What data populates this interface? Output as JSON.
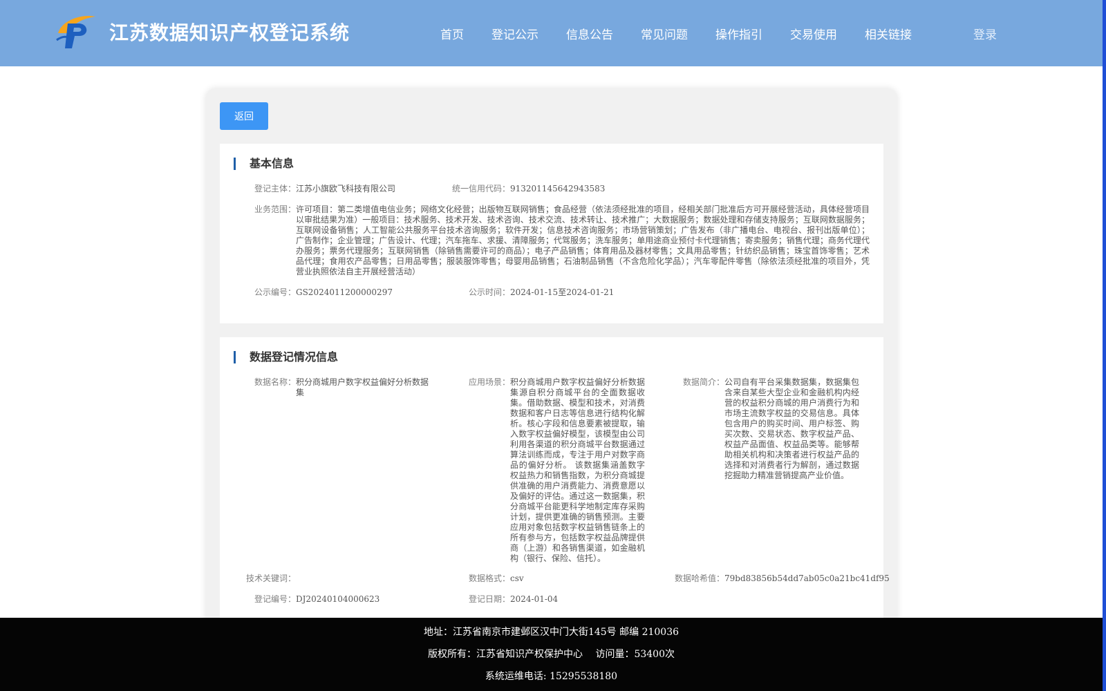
{
  "header": {
    "site_title": "江苏数据知识产权登记系统",
    "logo_icon": "ip-logo-icon",
    "nav": [
      "首页",
      "登记公示",
      "信息公告",
      "常见问题",
      "操作指引",
      "交易使用",
      "相关链接"
    ],
    "login": "登录"
  },
  "back_button": "返回",
  "basic_info": {
    "title": "基本信息",
    "entity_label": "登记主体：",
    "entity_value": "江苏小旗欧飞科技有限公司",
    "credit_label": "统一信用代码：",
    "credit_value": "91320114564294358З",
    "scope_label": "业务范围：",
    "scope_value": "许可项目：第二类增值电信业务；网络文化经营；出版物互联网销售；食品经营（依法须经批准的项目，经相关部门批准后方可开展经营活动，具体经营项目以审批结果为准）一般项目：技术服务、技术开发、技术咨询、技术交流、技术转让、技术推广；大数据服务；数据处理和存储支持服务；互联网数据服务；互联网设备销售；人工智能公共服务平台技术咨询服务；软件开发；信息技术咨询服务；市场营销策划；广告发布（非广播电台、电视台、报刊出版单位）；广告制作；企业管理；广告设计、代理；汽车拖车、求援、清障服务；代驾服务；洗车服务；单用途商业预付卡代理销售；寄卖服务；销售代理；商务代理代办服务；票务代理服务；互联网销售（除销售需要许可的商品）；电子产品销售；体育用品及器材零售；文具用品零售；针纺织品销售；珠宝首饰零售；艺术品代理；食用农产品零售；日用品零售；服装服饰零售；母婴用品销售；石油制品销售（不含危险化学品）；汽车零配件零售（除依法须经批准的项目外，凭营业执照依法自主开展经营活动）",
    "notice_no_label": "公示编号：",
    "notice_no_value": "GS2024011200000297",
    "notice_time_label": "公示时间：",
    "notice_time_value": "2024-01-15至2024-01-21"
  },
  "data_info": {
    "title": "数据登记情况信息",
    "name_label": "数据名称：",
    "name_value": "积分商城用户数字权益偏好分析数据集",
    "scene_label": "应用场景：",
    "scene_value": "积分商城用户数字权益偏好分析数据集源自积分商城平台的全面数据收集。借助数据、模型和技术，对消费数据和客户日志等信息进行结构化解析。核心字段和信息要素被提取，输入数字权益偏好模型，该模型由公司利用各渠道的积分商城平台数据通过算法训练而成，专注于用户对数字商品的偏好分析。 该数据集涵盖数字权益热力和销售指数，为积分商城提供准确的用户消费能力、消费意愿以及偏好的评估。通过这一数据集，积分商城平台能更科学地制定库存采购计划，提供更准确的销售预测。主要应用对象包括数字权益销售链条上的所有参与方，包括数字权益品牌提供商（上游）和各销售渠道，如金融机构（银行、保险、信托）。",
    "intro_label": "数据简介：",
    "intro_value": "公司自有平台采集数据集，数据集包含来自某些大型企业和金融机构内经营的权益积分商城的用户消费行为和市场主流数字权益的交易信息。具体包含用户的购买时间、用户标签、购买次数、交易状态、数字权益产品、权益产品面值、权益品类等。能够帮助相关机构和决策者进行权益产品的选择和对消费者行为解剖，通过数据挖掘助力精准营销提高产业价值。",
    "keyword_label": "技术关键词：",
    "keyword_value": "",
    "format_label": "数据格式：",
    "format_value": "csv",
    "hash_label": "数据哈希值：",
    "hash_value": "79bd83856b54dd7ab05c0a21bc41df95",
    "reg_no_label": "登记编号：",
    "reg_no_value": "DJ20240104000623",
    "reg_date_label": "登记日期：",
    "reg_date_value": "2024-01-04"
  },
  "footer": {
    "address": "地址：江苏省南京市建邺区汉中门大街145号 邮编 210036",
    "copyright": "版权所有：江苏省知识产权保护中心　 访问量：53400次",
    "phone": "系统运维电话: 15295538180"
  }
}
